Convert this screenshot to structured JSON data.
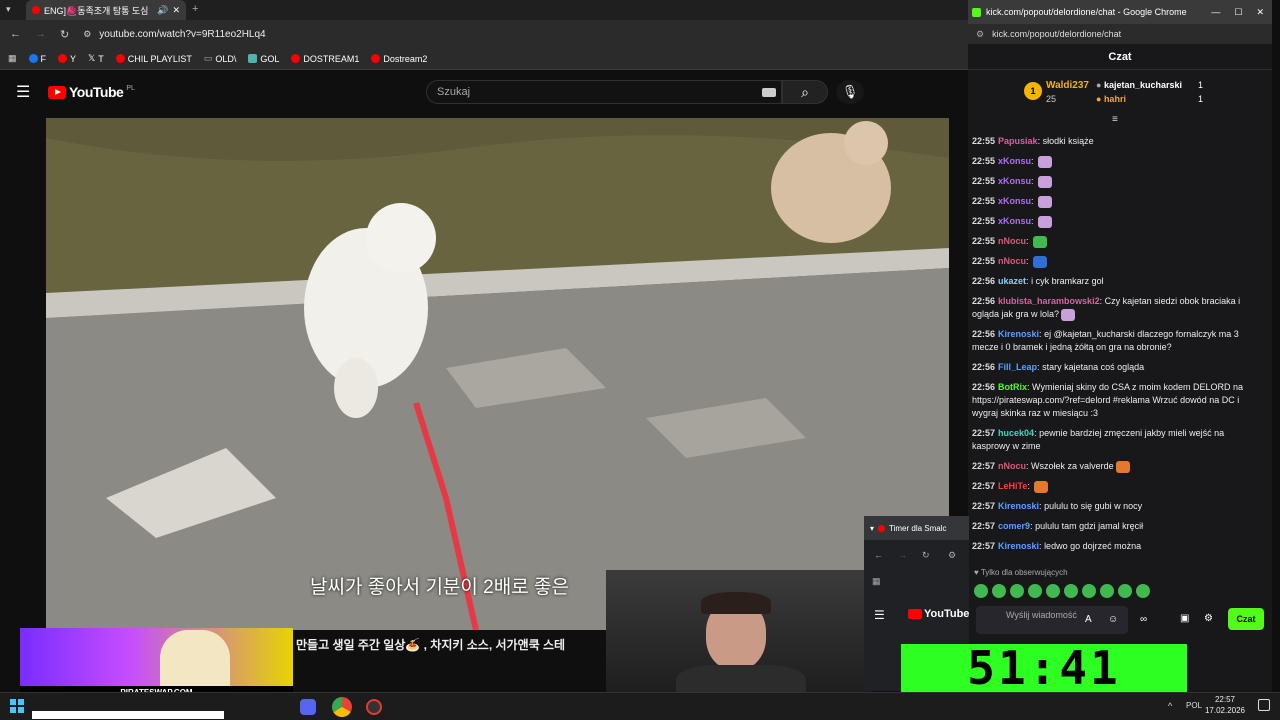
{
  "left_browser": {
    "tab_title": "ENG]🧶동족조개 탐통 도심",
    "url": "youtube.com/watch?v=9R11eo2HLq4",
    "bookmarks": [
      {
        "label": "F",
        "color": "#1877f2"
      },
      {
        "label": "Y",
        "color": "#ff0000"
      },
      {
        "label": "T",
        "color": "#ffffff"
      },
      {
        "label": "CHIL PLAYLIST",
        "color": "#ff0000"
      },
      {
        "label": "OLD\\",
        "color": "#888888"
      },
      {
        "label": "GOL",
        "color": "#4db6ac"
      },
      {
        "label": "DOSTREAM1",
        "color": "#ff0000"
      },
      {
        "label": "Dostream2",
        "color": "#ff0000"
      }
    ]
  },
  "youtube": {
    "logo": "YouTube",
    "region": "PL",
    "search_placeholder": "Szukaj",
    "caption": "날씨가 좋아서 기분이 2배로 좋은",
    "title_line": "만들고 생일 주간 일상🍝 , 차지키 소스, 서가앤쿡 스테",
    "promo_label": "PIRATESWAP.COM"
  },
  "chat_window": {
    "chrome_title": "kick.com/popout/delordione/chat - Google Chrome",
    "url": "kick.com/popout/delordione/chat",
    "header": "Czat",
    "leaderboard": {
      "first": {
        "rank": "1",
        "name": "Waldi237",
        "count": "25"
      },
      "others": [
        {
          "name": "kajetan_kucharski",
          "count": "1"
        },
        {
          "name": "hahri",
          "count": "1"
        }
      ]
    },
    "messages": [
      {
        "time": "22:55",
        "user": "Papusiak",
        "color": "#e05fa0",
        "text": "słodki książe",
        "emote": ""
      },
      {
        "time": "22:55",
        "user": "xKonsu",
        "color": "#b06bff",
        "text": "",
        "emote": "#c9a0dc"
      },
      {
        "time": "22:55",
        "user": "xKonsu",
        "color": "#b06bff",
        "text": "",
        "emote": "#c9a0dc"
      },
      {
        "time": "22:55",
        "user": "xKonsu",
        "color": "#b06bff",
        "text": "",
        "emote": "#c9a0dc"
      },
      {
        "time": "22:55",
        "user": "xKonsu",
        "color": "#b06bff",
        "text": "",
        "emote": "#c9a0dc"
      },
      {
        "time": "22:55",
        "user": "nNocu",
        "color": "#e0567a",
        "text": "",
        "emote": "#3fb950"
      },
      {
        "time": "22:55",
        "user": "nNocu",
        "color": "#e0567a",
        "text": "",
        "emote": "#2f6fd6"
      },
      {
        "time": "22:56",
        "user": "ukazet",
        "color": "#7fd3ff",
        "text": "i cyk bramkarz gol",
        "emote": ""
      },
      {
        "time": "22:56",
        "user": "klubista_harambowski2",
        "color": "#e05fa0",
        "text": "Czy kajetan siedzi obok braciaka i ogląda jak gra w lola?",
        "emote": "#c9a0dc"
      },
      {
        "time": "22:56",
        "user": "Kirenoski",
        "color": "#5aa0ff",
        "text": "ej @kajetan_kucharski dlaczego fornalczyk ma 3 mecze i 0 bramek i jedną żółtą on gra na obronie?",
        "emote": ""
      },
      {
        "time": "22:56",
        "user": "Fill_Leap",
        "color": "#5aa0ff",
        "text": "stary kajetana coś ogląda",
        "emote": ""
      },
      {
        "time": "22:56",
        "user": "BotRix",
        "color": "#53fc18",
        "text": "Wymieniaj skiny do CSA z moim kodem DELORD na https://pirateswap.com/?ref=delord #reklama Wrzuć dowód na DC i wygraj skinka raz w miesiącu :3",
        "emote": ""
      },
      {
        "time": "22:57",
        "user": "hucek04",
        "color": "#3fd8c0",
        "text": "pewnie bardziej zmęczeni jakby mieli wejść na kasprowy w zime",
        "emote": ""
      },
      {
        "time": "22:57",
        "user": "nNocu",
        "color": "#e0567a",
        "text": "Wszołek za valverde",
        "emote": "#e8772e"
      },
      {
        "time": "22:57",
        "user": "LeHiTe",
        "color": "#ff3b3b",
        "text": "",
        "emote": "#e8772e"
      },
      {
        "time": "22:57",
        "user": "Kirenoski",
        "color": "#5aa0ff",
        "text": "pululu to się gubi w nocy",
        "emote": ""
      },
      {
        "time": "22:57",
        "user": "comer9",
        "color": "#5aa0ff",
        "text": "pululu tam gdzi jamal kręcił",
        "emote": ""
      },
      {
        "time": "22:57",
        "user": "Kirenoski",
        "color": "#5aa0ff",
        "text": "ledwo go dojrzeć można",
        "emote": ""
      }
    ],
    "followers_only": "Tylko dla obserwujących",
    "input_placeholder": "Wyślij wiadomość",
    "send_label": "Czat"
  },
  "timer_window": {
    "tab_title": "Timer dla Smalc",
    "yt_logo": "YouTube",
    "clock": "51:41"
  },
  "taskbar": {
    "language": "POL",
    "time": "22:57",
    "date": "17.02.2026"
  }
}
